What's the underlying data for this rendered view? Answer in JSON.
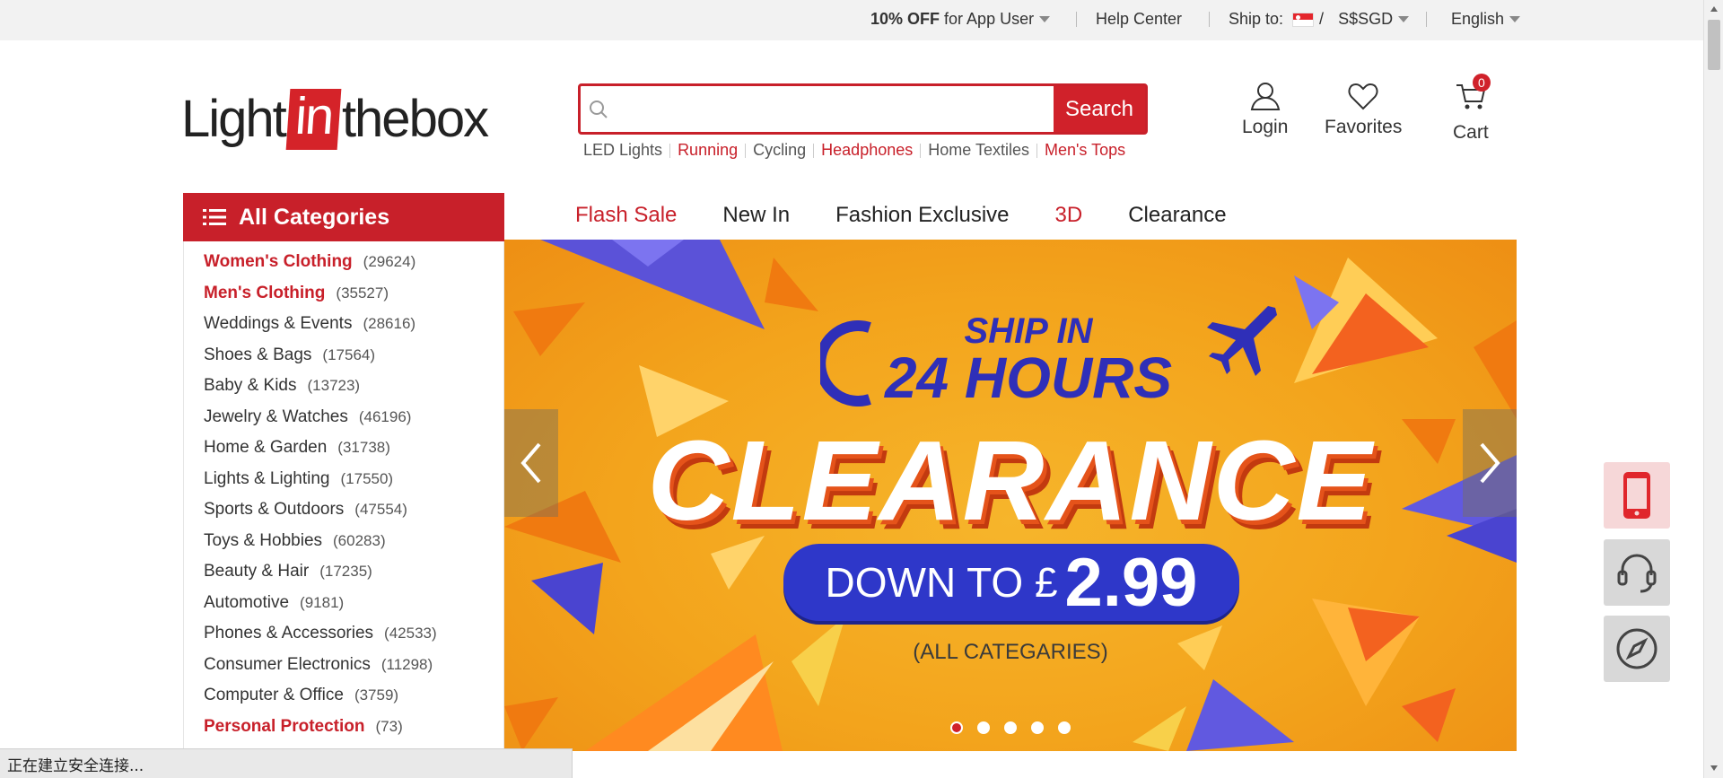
{
  "topbar": {
    "promo_bold": "10% OFF",
    "promo_rest": " for App User",
    "help": "Help Center",
    "ship_label": "Ship to:",
    "ship_sep": "/",
    "currency": "S$SGD",
    "language": "English"
  },
  "logo": {
    "pre": "Light",
    "mid": "in",
    "post": "thebox"
  },
  "search": {
    "placeholder": "",
    "value": "",
    "button_label": "Search"
  },
  "hot_links": [
    {
      "label": "LED Lights",
      "red": false
    },
    {
      "label": "Running",
      "red": true
    },
    {
      "label": "Cycling",
      "red": false
    },
    {
      "label": "Headphones",
      "red": true
    },
    {
      "label": "Home Textiles",
      "red": false
    },
    {
      "label": "Men's Tops",
      "red": true
    }
  ],
  "header_actions": {
    "login": "Login",
    "favorites": "Favorites",
    "cart": "Cart",
    "cart_count": "0"
  },
  "categories": {
    "title": "All Categories",
    "items": [
      {
        "name": "Women's Clothing",
        "count": "(29624)",
        "red": true
      },
      {
        "name": "Men's Clothing",
        "count": "(35527)",
        "red": true
      },
      {
        "name": "Weddings & Events",
        "count": "(28616)",
        "red": false
      },
      {
        "name": "Shoes & Bags",
        "count": "(17564)",
        "red": false
      },
      {
        "name": "Baby & Kids",
        "count": "(13723)",
        "red": false
      },
      {
        "name": "Jewelry & Watches",
        "count": "(46196)",
        "red": false
      },
      {
        "name": "Home & Garden",
        "count": "(31738)",
        "red": false
      },
      {
        "name": "Lights & Lighting",
        "count": "(17550)",
        "red": false
      },
      {
        "name": "Sports & Outdoors",
        "count": "(47554)",
        "red": false
      },
      {
        "name": "Toys & Hobbies",
        "count": "(60283)",
        "red": false
      },
      {
        "name": "Beauty & Hair",
        "count": "(17235)",
        "red": false
      },
      {
        "name": "Automotive",
        "count": "(9181)",
        "red": false
      },
      {
        "name": "Phones & Accessories",
        "count": "(42533)",
        "red": false
      },
      {
        "name": "Consumer Electronics",
        "count": "(11298)",
        "red": false
      },
      {
        "name": "Computer & Office",
        "count": "(3759)",
        "red": false
      },
      {
        "name": "Personal Protection",
        "count": "(73)",
        "red": true
      }
    ]
  },
  "nav": [
    {
      "label": "Flash Sale",
      "red": true
    },
    {
      "label": "New In",
      "red": false
    },
    {
      "label": "Fashion Exclusive",
      "red": false
    },
    {
      "label": "3D",
      "red": true
    },
    {
      "label": "Clearance",
      "red": false
    }
  ],
  "banner": {
    "ship_line1": "SHIP IN",
    "ship_line2": "24 HOURS",
    "headline": "CLEARANCE",
    "price_prefix": "DOWN TO £",
    "price": "2.99",
    "note": "(ALL CATEGARIES)",
    "active_slide": 1,
    "slide_count": 5
  },
  "colors": {
    "brand_red": "#c8202a",
    "banner_blue": "#2e37c9",
    "banner_orange": "#f3a41c"
  },
  "floating_icons": [
    "mobile-app-icon",
    "customer-service-icon",
    "compass-icon"
  ],
  "status_bar": "正在建立安全连接..."
}
